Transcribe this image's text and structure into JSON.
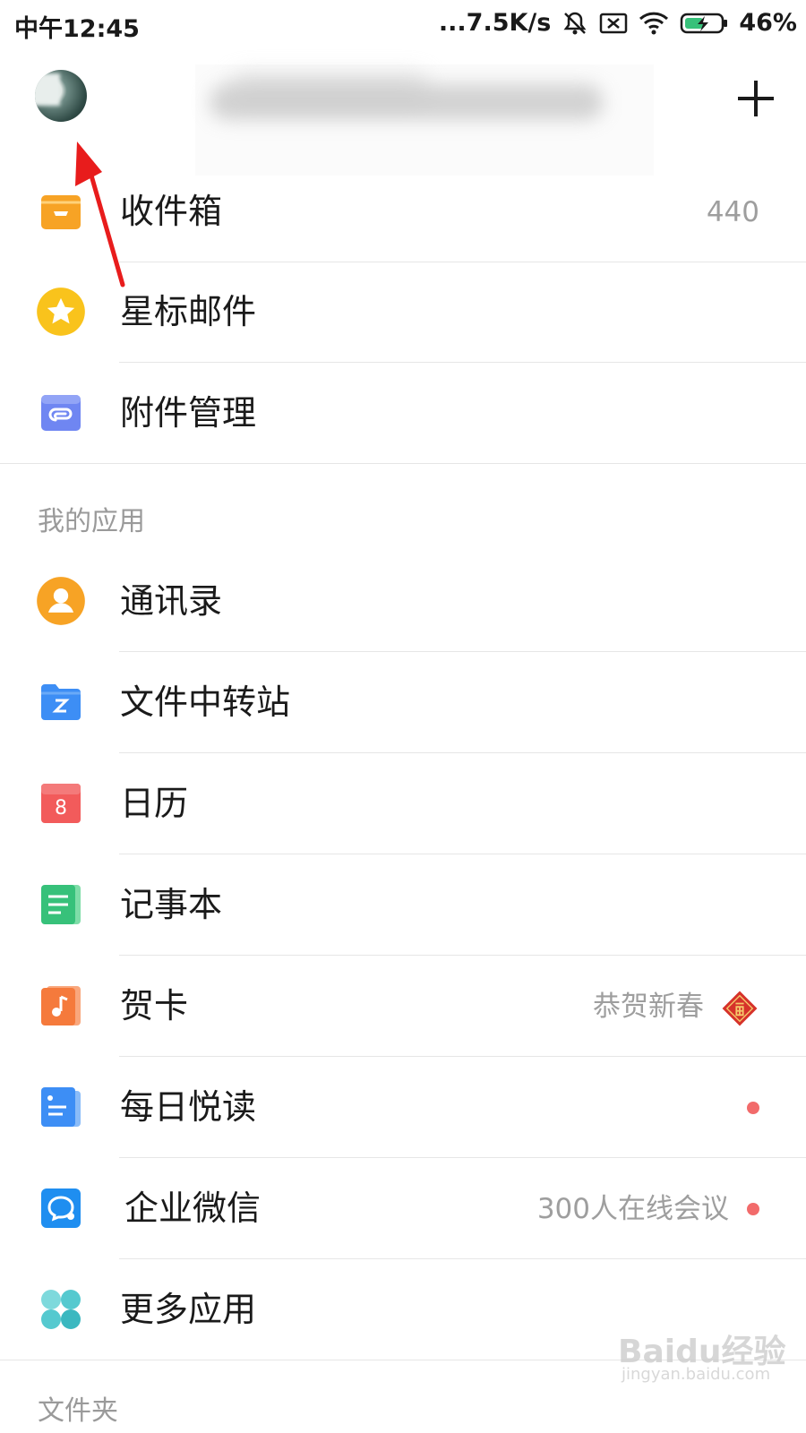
{
  "status_bar": {
    "time": "中午12:45",
    "network_speed": "...7.5K/s",
    "battery": "46%"
  },
  "header": {
    "avatar": "avatar",
    "add_icon": "plus-icon"
  },
  "mail_items": [
    {
      "label": "收件箱",
      "icon": "inbox-icon",
      "count": "440"
    },
    {
      "label": "星标邮件",
      "icon": "star-icon"
    },
    {
      "label": "附件管理",
      "icon": "attachment-icon"
    }
  ],
  "apps_section": {
    "title": "我的应用",
    "items": [
      {
        "label": "通讯录",
        "icon": "contacts-icon"
      },
      {
        "label": "文件中转站",
        "icon": "folder-icon"
      },
      {
        "label": "日历",
        "icon": "calendar-icon",
        "calendar_day": "8"
      },
      {
        "label": "记事本",
        "icon": "notepad-icon"
      },
      {
        "label": "贺卡",
        "icon": "greeting-card-icon",
        "meta": "恭贺新春"
      },
      {
        "label": "每日悦读",
        "icon": "daily-reading-icon"
      },
      {
        "label": "企业微信",
        "icon": "wecom-icon",
        "meta": "300人在线会议"
      },
      {
        "label": "更多应用",
        "icon": "more-apps-icon"
      }
    ]
  },
  "folders_section": {
    "title": "文件夹"
  },
  "watermark": {
    "brand": "Baidu经验",
    "url": "jingyan.baidu.com"
  },
  "colors": {
    "inbox": "#f7a325",
    "star": "#f9c31c",
    "attachment": "#6f86f2",
    "contacts": "#f7a325",
    "folder": "#3d8ef5",
    "calendar": "#f25b5b",
    "notepad": "#37c17a",
    "greeting": "#f57a3c",
    "reading": "#3d8ef5",
    "wecom": "#1f8ef0",
    "more": "#55c9cf",
    "badge_dot": "#f26b6b",
    "annotation_arrow": "#e81c1c"
  }
}
